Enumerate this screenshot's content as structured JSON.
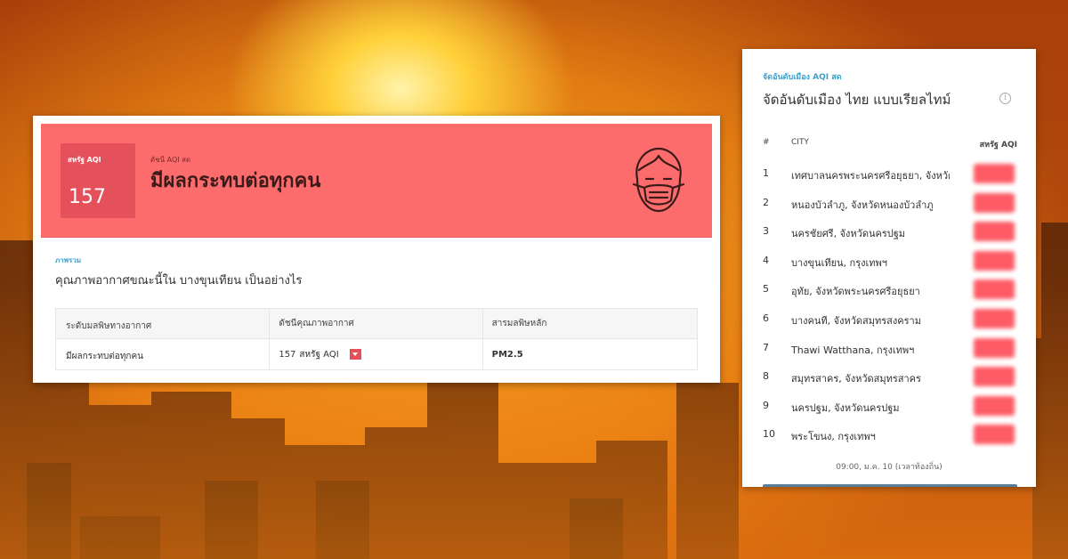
{
  "aqi_card": {
    "box_label": "สหรัฐ AQI",
    "aqi_value": "157",
    "sub_label": "ดัชนี AQI สด",
    "status": "มีผลกระทบต่อทุกคน",
    "status_color": "#fd6c6c",
    "icon": "face-mask-icon"
  },
  "overview": {
    "label": "ภาพรวม",
    "question": "คุณภาพอากาศขณะนี้ใน บางขุนเทียน เป็นอย่างไร"
  },
  "summary_table": {
    "headers": [
      "ระดับมลพิษทางอากาศ",
      "ดัชนีคุณภาพอากาศ",
      "สารมลพิษหลัก"
    ],
    "row": {
      "level": "มีผลกระทบต่อทุกคน",
      "aqi_value": "157",
      "aqi_unit": "สหรัฐ AQI",
      "pollutant": "PM2.5"
    }
  },
  "ranking": {
    "subtitle": "จัดอันดับเมือง AQI สด",
    "title": "จัดอันดับเมือง ไทย แบบเรียลไทม์",
    "columns": {
      "num": "#",
      "city": "CITY",
      "aqi": "สหรัฐ AQI"
    },
    "items": [
      {
        "rank": "1",
        "city": "เทศบาลนครพระนครศรีอยุธยา, จังหวัดพระนครศรีอยุธยา"
      },
      {
        "rank": "2",
        "city": "หนองบัวลำภู, จังหวัดหนองบัวลำภู"
      },
      {
        "rank": "3",
        "city": "นครชัยศรี, จังหวัดนครปฐม"
      },
      {
        "rank": "4",
        "city": "บางขุนเทียน, กรุงเทพฯ"
      },
      {
        "rank": "5",
        "city": "อุทัย, จังหวัดพระนครศรีอยุธยา"
      },
      {
        "rank": "6",
        "city": "บางคนที, จังหวัดสมุทรสงคราม"
      },
      {
        "rank": "7",
        "city": "Thawi Watthana, กรุงเทพฯ"
      },
      {
        "rank": "8",
        "city": "สมุทรสาคร, จังหวัดสมุทรสาคร"
      },
      {
        "rank": "9",
        "city": "นครปฐม, จังหวัดนครปฐม"
      },
      {
        "rank": "10",
        "city": "พระโขนง, กรุงเทพฯ"
      }
    ],
    "footer": "09:00, ม.ค. 10 (เวลาท้องถิ่น)",
    "badge_color": "#fd5c66"
  }
}
